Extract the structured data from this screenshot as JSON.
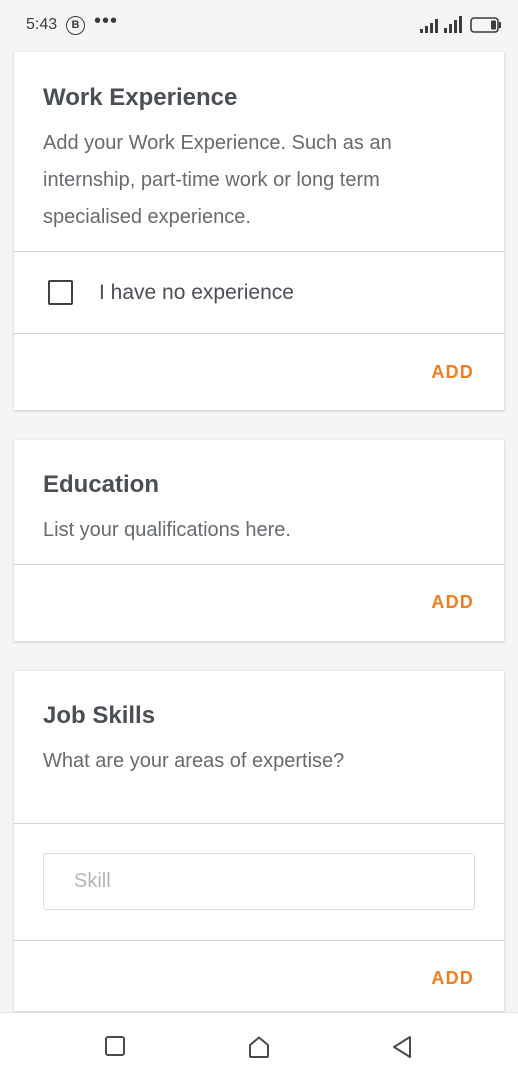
{
  "status_bar": {
    "time": "5:43",
    "badge": "B",
    "dots": "•••"
  },
  "work_experience": {
    "title": "Work Experience",
    "description": "Add your Work Experience. Such as an internship, part-time work or long term specialised experience.",
    "no_experience_label": "I have no experience",
    "no_experience_checked": false,
    "add_label": "ADD"
  },
  "education": {
    "title": "Education",
    "description": "List your qualifications here.",
    "add_label": "ADD"
  },
  "job_skills": {
    "title": "Job Skills",
    "description": "What are your areas of expertise?",
    "skill_value": "",
    "skill_placeholder": "Skill",
    "add_label": "ADD"
  },
  "colors": {
    "accent": "#f07d1f",
    "text": "#4a4f55",
    "muted": "#666b70",
    "background": "#f5f5f5"
  },
  "icons": {
    "nav_recent": "square-icon",
    "nav_home": "home-icon",
    "nav_back": "back-triangle-icon"
  }
}
